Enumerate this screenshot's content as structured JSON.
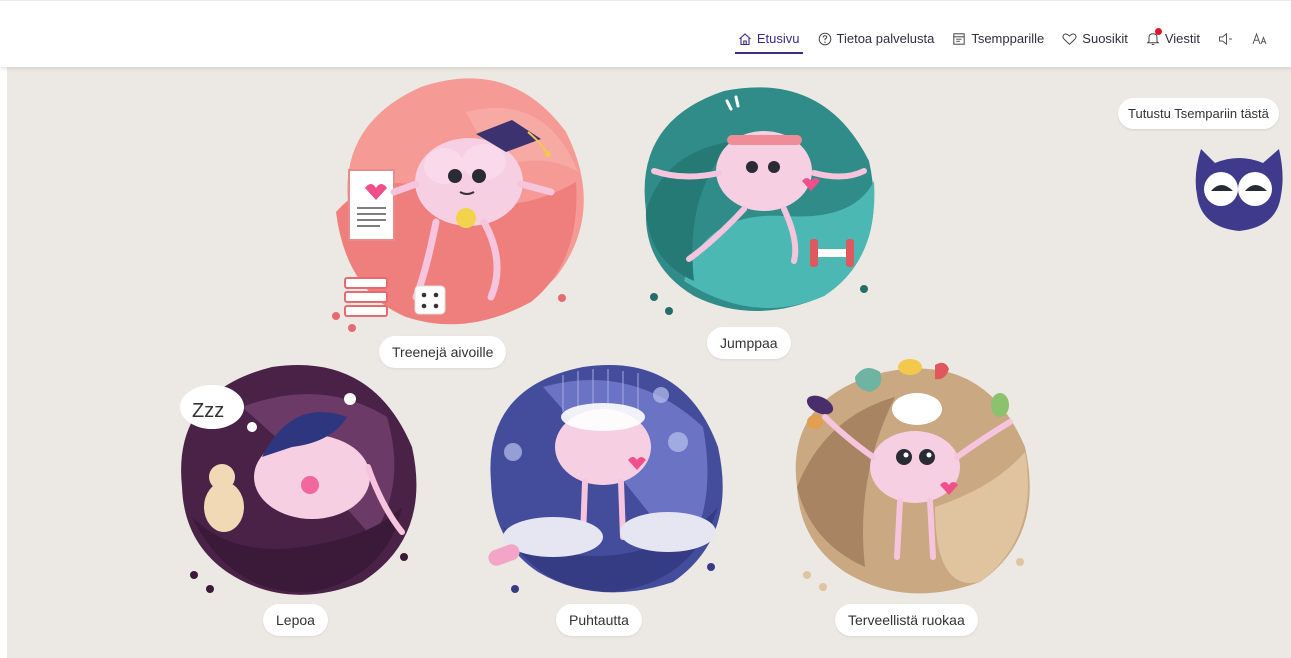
{
  "nav": {
    "items": [
      {
        "label": "Etusivu",
        "icon": "home-icon",
        "active": true
      },
      {
        "label": "Tietoa palvelusta",
        "icon": "help-icon"
      },
      {
        "label": "Tsempparille",
        "icon": "document-icon"
      },
      {
        "label": "Suosikit",
        "icon": "heart-icon"
      },
      {
        "label": "Viestit",
        "icon": "bell-icon",
        "badge": true
      }
    ],
    "sound_icon": "speaker-icon",
    "text_size_icon": "text-size-icon"
  },
  "cards": [
    {
      "label": "Treenejä aivoille",
      "color": "#f07f7f"
    },
    {
      "label": "Jumppaa",
      "color": "#3aa3a0"
    },
    {
      "label": "Lepoa",
      "color": "#5a2a54"
    },
    {
      "label": "Puhtautta",
      "color": "#5c63b8"
    },
    {
      "label": "Terveellistä ruokaa",
      "color": "#c9a882"
    }
  ],
  "tour": {
    "label": "Tutustu Tsempariin tästä"
  },
  "colors": {
    "accent": "#3b2b8a",
    "background": "#ece8e3",
    "badge": "#e0152b"
  }
}
